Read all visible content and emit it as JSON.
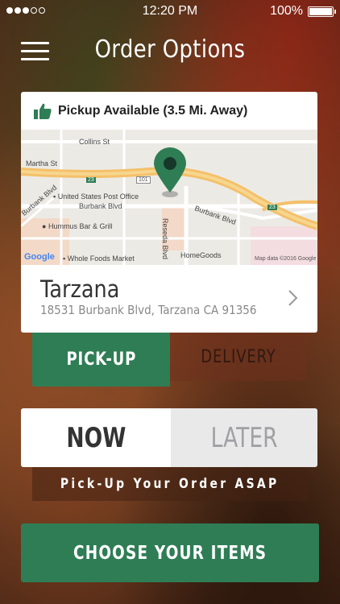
{
  "status_bar": {
    "time": "12:20 PM",
    "battery": "100%"
  },
  "header": {
    "title": "Order Options",
    "menu_icon": "hamburger-menu-icon"
  },
  "location_card": {
    "availability": "Pickup Available (3.5 Mi. Away)",
    "availability_icon": "thumbs-up-icon",
    "map": {
      "labels": {
        "collins": "Collins St",
        "martha": "Martha St",
        "burbank1": "Burbank Blvd",
        "burbank2": "Burbank Blvd",
        "burbank3": "Burbank Blvd",
        "post_office": "United States Post Office",
        "hummus": "Hummus Bar & Grill",
        "whole_foods": "Whole Foods Market",
        "reseda": "Reseda Blvd",
        "homegoods": "HomeGoods",
        "highway_101": "101",
        "shield_23a": "23",
        "shield_23b": "23",
        "attribution": "Map data ©2016 Google",
        "google": "Google"
      }
    },
    "name": "Tarzana",
    "address": "18531 Burbank Blvd, Tarzana CA 91356"
  },
  "fulfillment": {
    "pickup": "PICK-UP",
    "delivery": "DELIVERY",
    "selected": "pickup"
  },
  "timing": {
    "now": "NOW",
    "later": "LATER",
    "selected": "now",
    "note": "Pick-Up Your Order ASAP"
  },
  "cta": {
    "label": "CHOOSE YOUR ITEMS"
  },
  "colors": {
    "accent_green": "#2f7d55",
    "map_pin": "#2f7d55"
  }
}
